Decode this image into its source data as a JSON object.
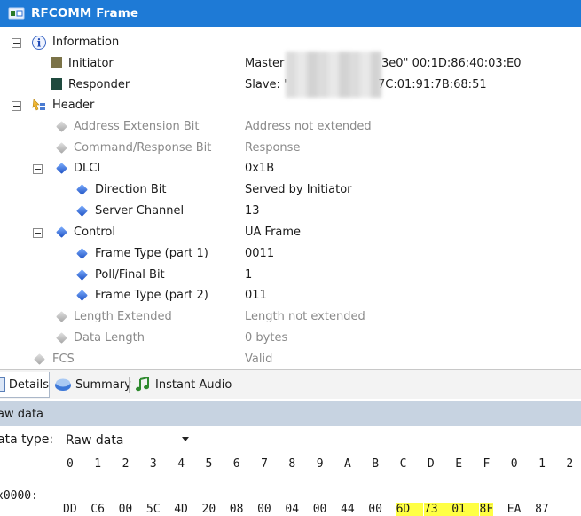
{
  "window": {
    "title": "RFCOMM Frame"
  },
  "tree": {
    "information": {
      "label": "Information"
    },
    "initiator": {
      "label": "Initiator",
      "value_start": "Master",
      "value_end": "3e0\" 00:1D:86:40:03:E0",
      "color": "#7b7348"
    },
    "responder": {
      "label": "Responder",
      "value_start": "Slave: '",
      "value_end": "7C:01:91:7B:68:51",
      "color": "#1f4a3e"
    },
    "header": {
      "label": "Header"
    },
    "address_extension_bit": {
      "label": "Address Extension Bit",
      "value": "Address not extended"
    },
    "command_response_bit": {
      "label": "Command/Response Bit",
      "value": "Response"
    },
    "dlci": {
      "label": "DLCI",
      "value": "0x1B"
    },
    "direction_bit": {
      "label": "Direction Bit",
      "value": "Served by Initiator"
    },
    "server_channel": {
      "label": "Server Channel",
      "value": "13"
    },
    "control": {
      "label": "Control",
      "value": "UA Frame"
    },
    "frame_type_1": {
      "label": "Frame Type (part 1)",
      "value": "0011"
    },
    "poll_final_bit": {
      "label": "Poll/Final Bit",
      "value": "1"
    },
    "frame_type_2": {
      "label": "Frame Type (part 2)",
      "value": "011"
    },
    "length_extended": {
      "label": "Length Extended",
      "value": "Length not extended"
    },
    "data_length": {
      "label": "Data Length",
      "value": "0 bytes"
    },
    "fcs": {
      "label": "FCS",
      "value": "Valid"
    }
  },
  "tabs": {
    "details": "Details",
    "summary": "Summary",
    "instant_audio": "Instant Audio"
  },
  "raw": {
    "header": "aw data",
    "data_type_label": "ata type:",
    "data_type_value": "Raw data",
    "columns": [
      "0",
      "1",
      "2",
      "3",
      "4",
      "5",
      "6",
      "7",
      "8",
      "9",
      "A",
      "B",
      "C",
      "D",
      "E",
      "F",
      "0",
      "1",
      "2"
    ],
    "address": "x0000:",
    "bytes": [
      "DD",
      "C6",
      "00",
      "5C",
      "4D",
      "20",
      "08",
      "00",
      "04",
      "00",
      "44",
      "00",
      "6D",
      "73",
      "01",
      "8F",
      "EA",
      "87"
    ]
  },
  "colors": {
    "accent": "#1e7ad6",
    "raw_header_bg": "#c7d3e1",
    "highlight": "#ffff44"
  }
}
